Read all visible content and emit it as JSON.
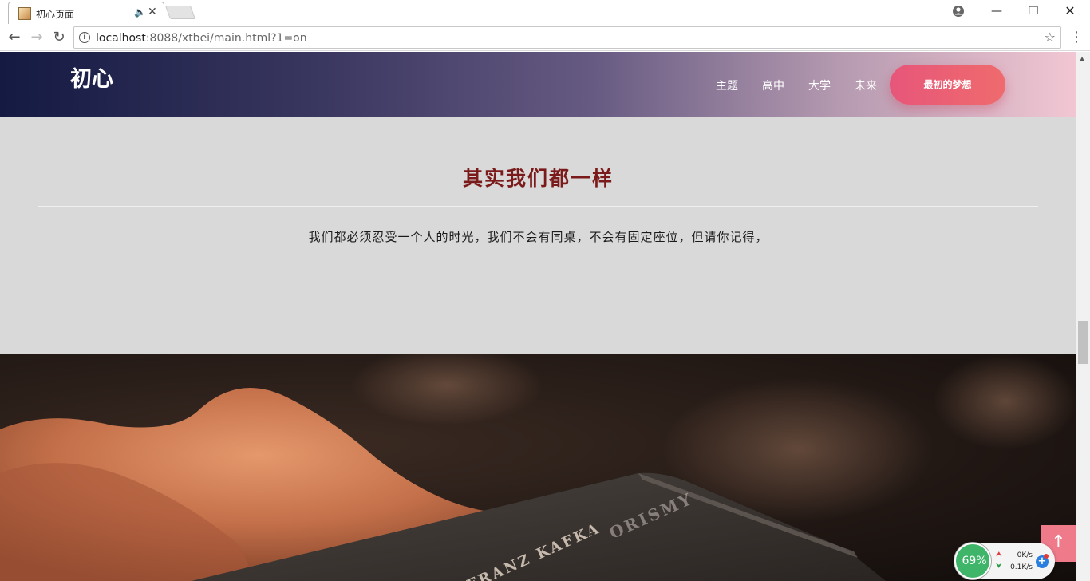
{
  "browser": {
    "tab_title": "初心页面",
    "url_host": "localhost",
    "url_rest": ":8088/xtbei/main.html?1=on",
    "favicon_icon": "page-favicon",
    "audio_icon": "speaker-icon",
    "close_glyph": "✕"
  },
  "site": {
    "brand": "初心",
    "nav": [
      "主题",
      "高中",
      "大学",
      "未来"
    ],
    "cta_label": "最初的梦想",
    "header_gradient": [
      "#141a42",
      "#665a82",
      "#f2c7d3"
    ],
    "cta_color": "#e7567a"
  },
  "section": {
    "title": "其实我们都一样",
    "title_color": "#7a1a1a",
    "text": "我们都必须忍受一个人的时光，我们不会有同桌，不会有固定座位，但请你记得，"
  },
  "photo": {
    "book_title": "FRANZ KAFKA",
    "book_subtitle": "ORISMY"
  },
  "overlay": {
    "to_top_icon": "arrow-up-icon",
    "to_top_glyph": "↑",
    "net_percent": "69%",
    "net_up": "0K/s",
    "net_down": "0.1K/s"
  }
}
